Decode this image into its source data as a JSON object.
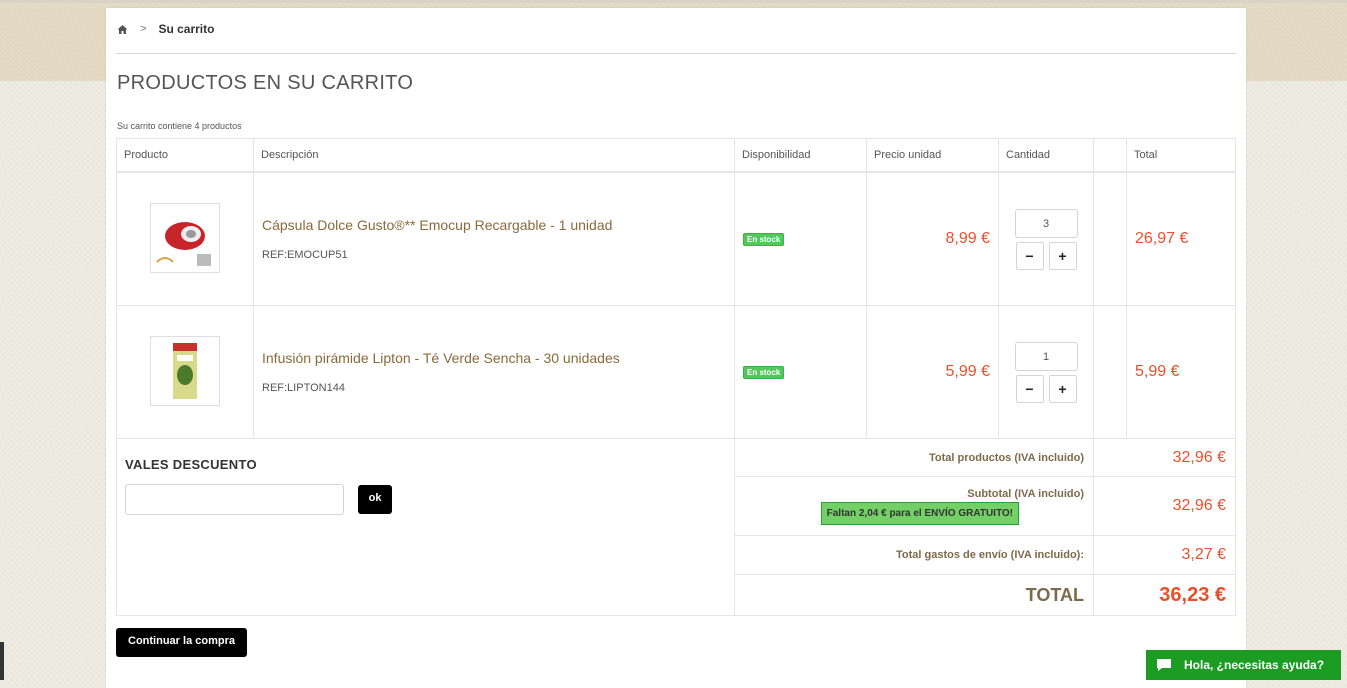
{
  "breadcrumb": {
    "separator": ">",
    "current": "Su carrito"
  },
  "page_title": "PRODUCTOS EN SU CARRITO",
  "cart_summary": "Su carrito contiene 4 productos",
  "table": {
    "headers": [
      "Producto",
      "Descripción",
      "Disponibilidad",
      "Precio unidad",
      "Cantidad",
      "",
      "Total"
    ]
  },
  "products": [
    {
      "name": "Cápsula Dolce Gusto®** Emocup Recargable - 1 unidad",
      "ref": "REF:EMOCUP51",
      "availability": "En stock",
      "unit_price": "8,99 €",
      "quantity": "3",
      "total": "26,97 €"
    },
    {
      "name": "Infusión pirámide Lipton - Té Verde Sencha - 30 unidades",
      "ref": "REF:LIPTON144",
      "availability": "En stock",
      "unit_price": "5,99 €",
      "quantity": "1",
      "total": "5,99 €"
    }
  ],
  "qty_controls": {
    "minus": "−",
    "plus": "+"
  },
  "vouchers": {
    "title": "VALES DESCUENTO",
    "button": "ok",
    "placeholder": ""
  },
  "summary": {
    "total_products_label": "Total productos (IVA incluido)",
    "total_products_value": "32,96 €",
    "subtotal_label": "Subtotal (IVA incluido)",
    "subtotal_value": "32,96 €",
    "free_shipping_notice": "Faltan 2,04 € para el ENVÍO GRATUITO!",
    "shipping_label": "Total gastos de envío (IVA incluido):",
    "shipping_value": "3,27 €",
    "grand_label": "TOTAL",
    "grand_value": "36,23 €"
  },
  "continue_button": "Continuar la compra",
  "chat": {
    "label": "Hola, ¿necesitas ayuda?"
  },
  "colors": {
    "price": "#e8502c",
    "stock_badge": "#55c65e",
    "chat": "#1c9c22",
    "link": "#8a6a3a"
  }
}
